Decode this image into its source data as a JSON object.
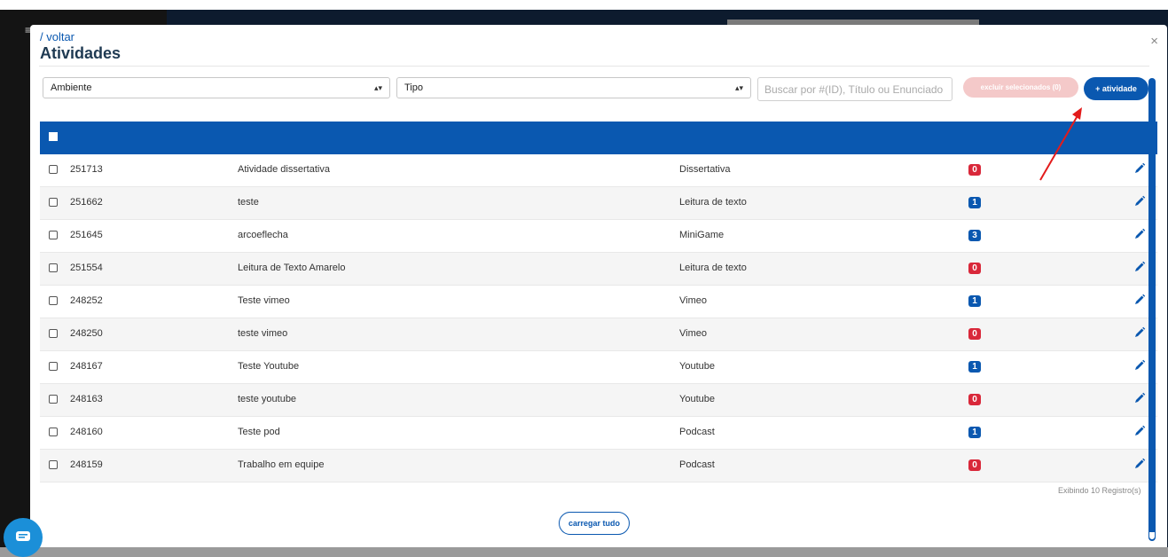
{
  "modal": {
    "back_link": "/ voltar",
    "title": "Atividades",
    "close_label": "×"
  },
  "filters": {
    "ambiente": "Ambiente",
    "tipo": "Tipo",
    "search_placeholder": "Buscar por #(ID), Título ou Enunciado",
    "delete_label": "excluir selecionados (0)",
    "add_label": "+ atividade"
  },
  "rows": [
    {
      "id": "251713",
      "name": "Atividade dissertativa",
      "type": "Dissertativa",
      "count": "0",
      "color": "#d9283a"
    },
    {
      "id": "251662",
      "name": "teste",
      "type": "Leitura de texto",
      "count": "1",
      "color": "#0a58b0"
    },
    {
      "id": "251645",
      "name": "arcoeflecha",
      "type": "MiniGame",
      "count": "3",
      "color": "#0a58b0"
    },
    {
      "id": "251554",
      "name": "Leitura de Texto Amarelo",
      "type": "Leitura de texto",
      "count": "0",
      "color": "#d9283a"
    },
    {
      "id": "248252",
      "name": "Teste vimeo",
      "type": "Vimeo",
      "count": "1",
      "color": "#0a58b0"
    },
    {
      "id": "248250",
      "name": "teste vimeo",
      "type": "Vimeo",
      "count": "0",
      "color": "#d9283a"
    },
    {
      "id": "248167",
      "name": "Teste Youtube",
      "type": "Youtube",
      "count": "1",
      "color": "#0a58b0"
    },
    {
      "id": "248163",
      "name": "teste youtube",
      "type": "Youtube",
      "count": "0",
      "color": "#d9283a"
    },
    {
      "id": "248160",
      "name": "Teste pod",
      "type": "Podcast",
      "count": "1",
      "color": "#0a58b0"
    },
    {
      "id": "248159",
      "name": "Trabalho em equipe",
      "type": "Podcast",
      "count": "0",
      "color": "#d9283a"
    }
  ],
  "footer": {
    "count_text": "Exibindo 10 Registro(s)",
    "load_all": "carregar tudo"
  },
  "colors": {
    "primary": "#0a58b0",
    "danger": "#d9283a"
  }
}
